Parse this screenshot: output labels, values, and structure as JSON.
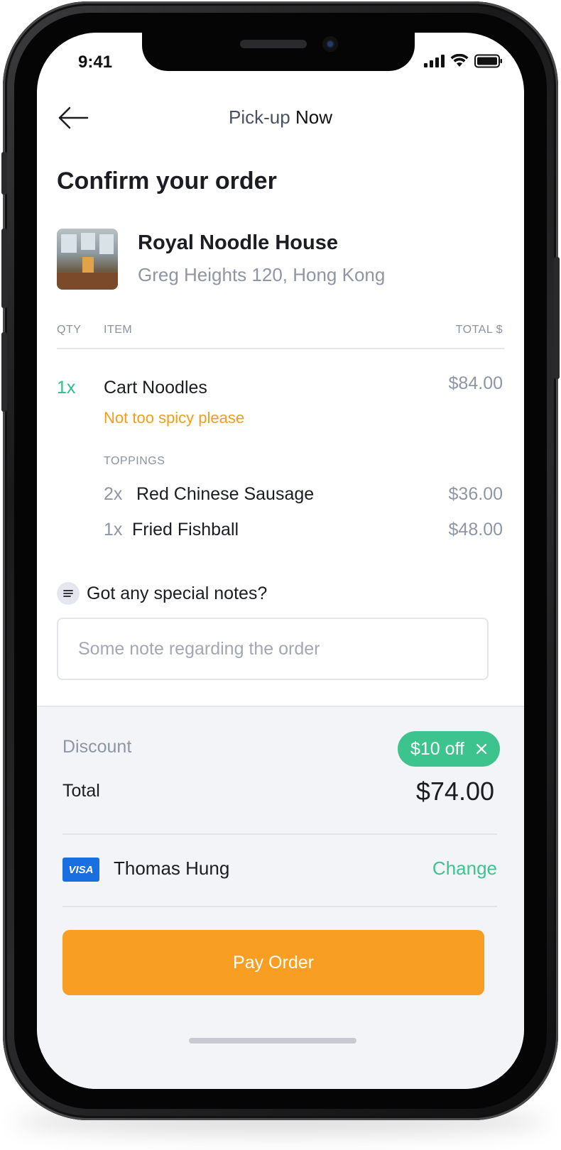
{
  "status_bar": {
    "time": "9:41"
  },
  "header": {
    "title_prefix": "Pick-up",
    "title_suffix": "Now"
  },
  "page_title": "Confirm your order",
  "restaurant": {
    "name": "Royal Noodle House",
    "address": "Greg Heights 120, Hong Kong"
  },
  "table_headers": {
    "qty": "QTY",
    "item": "ITEM",
    "total": "TOTAL $"
  },
  "order_item": {
    "qty": "1x",
    "name": "Cart Noodles",
    "price": "$84.00",
    "note": "Not too spicy please",
    "toppings_label": "TOPPINGS",
    "toppings": [
      {
        "qty": "2x",
        "name": "Red Chinese Sausage",
        "price": "$36.00"
      },
      {
        "qty": "1x",
        "name": "Fried Fishball",
        "price": "$48.00"
      }
    ]
  },
  "notes": {
    "label": "Got any special notes?",
    "placeholder": "Some note regarding the order",
    "value": ""
  },
  "summary": {
    "discount_label": "Discount",
    "discount_chip": "$10 off",
    "total_label": "Total",
    "total_value": "$74.00"
  },
  "payment": {
    "card_brand": "VISA",
    "card_holder": "Thomas Hung",
    "change_label": "Change"
  },
  "pay_button": "Pay Order",
  "colors": {
    "accent_green": "#3dc48e",
    "accent_orange": "#f89e22",
    "visa_blue": "#1a6fe0"
  }
}
